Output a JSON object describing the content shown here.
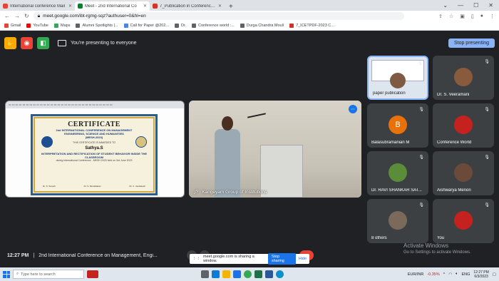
{
  "browser": {
    "tabs": [
      {
        "title": "International conference Mail",
        "color": "#ea4335",
        "active": false
      },
      {
        "title": "Meet - 2nd International Co",
        "color": "#00832d",
        "active": true
      },
      {
        "title": "7_Publication in Conference pro",
        "color": "#d93025",
        "active": false
      }
    ],
    "new_tab": "+",
    "url": "meet.google.com/ibt-rgmg-sqz?authuser=0&hl=en"
  },
  "bookmarks": [
    {
      "label": "Gmail",
      "color": "#ea4335"
    },
    {
      "label": "YouTube",
      "color": "#ff0000"
    },
    {
      "label": "Maps",
      "color": "#34a853"
    },
    {
      "label": "Alumni Spotlights |...",
      "color": "#5f6368"
    },
    {
      "label": "Call for Paper @202...",
      "color": "#4285f4"
    },
    {
      "label": "Dr.",
      "color": "#5f6368"
    },
    {
      "label": "Conference world :...",
      "color": "#5f6368"
    },
    {
      "label": "Durga Chandra Mouli",
      "color": "#5f6368"
    },
    {
      "label": "7_ICETPDF-2023 C...",
      "color": "#d93025"
    }
  ],
  "meet": {
    "presenting_text": "You're presenting to everyone",
    "stop_presenting": "Stop presenting",
    "camera_label": "Kangeyam Group of Institutions",
    "time": "12:27 PM",
    "separator": "|",
    "meeting_title": "2nd International Conference on Management, Engi...",
    "share_notice": "meet.google.com is sharing a window.",
    "stop_sharing": "Stop sharing",
    "hide": "Hide"
  },
  "certificate": {
    "title": "CERTIFICATE",
    "line1": "2nd INTERNATIONAL CONFERENCE ON MANAGEMENT",
    "line2": "ENGINEERING, SCIENCE AND HUMANITIES",
    "line3": "(MESH-2023)",
    "awarded": "THIS CERTIFICATE IS AWARDED TO",
    "name": "Sathya.S",
    "paper": "INTERPRETATION AND RECTIFICATION OF STUDENT BEHAVIOR INSIDE THE CLASSROOM",
    "event": "during International Conference - MESH 2023 held on 3rd June 2023",
    "sig1": "Dr. S. Suresh",
    "sig2": "Dr. S. Muralidaran",
    "sig3": "Dr. C. Venkatesh"
  },
  "participants": [
    {
      "name": "paper publication",
      "type": "slide"
    },
    {
      "name": "Dr. S. Veeramani",
      "type": "photo",
      "color": "#8a5a3c"
    },
    {
      "name": "Balasubramanian M",
      "type": "letter",
      "letter": "B",
      "color": "#e8710a"
    },
    {
      "name": "Conference World",
      "type": "photo",
      "color": "#c5221f"
    },
    {
      "name": "Dr. RAVI SHANKAR SAT...",
      "type": "photo",
      "color": "#5b8c3a"
    },
    {
      "name": "Aishwarya Menon",
      "type": "photo",
      "color": "#6b4a3a"
    },
    {
      "name": "8 others",
      "type": "group",
      "color": "#7b6a5c"
    },
    {
      "name": "You",
      "type": "photo",
      "color": "#c5221f"
    }
  ],
  "windows": {
    "activate": "Activate Windows",
    "activate_sub": "Go to Settings to activate Windows."
  },
  "taskbar": {
    "search_placeholder": "Type here to search",
    "ticker": "EUR/INR",
    "ticker_value": "-0.35%",
    "lang": "ENG",
    "time": "12:27 PM",
    "date": "6/3/2023"
  }
}
